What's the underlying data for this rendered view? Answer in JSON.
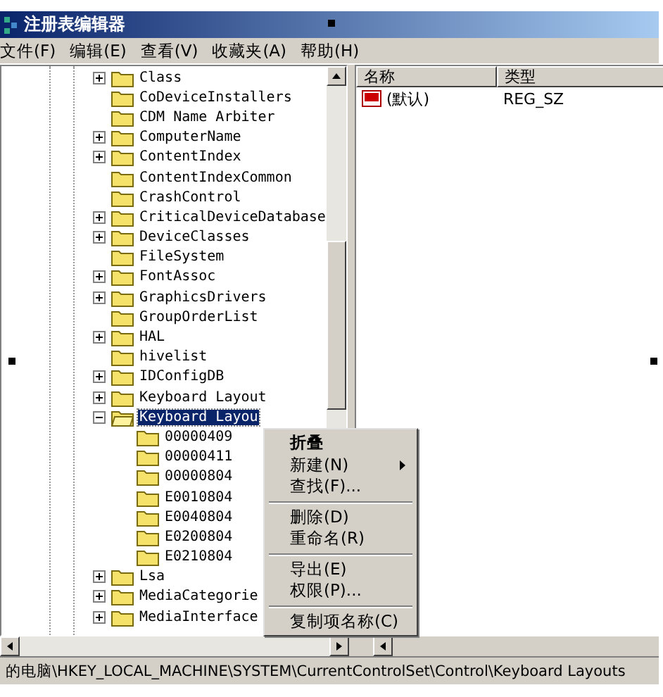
{
  "window": {
    "title": "注册表编辑器"
  },
  "menu_bar": [
    "文件(F)",
    "编辑(E)",
    "查看(V)",
    "收藏夹(A)",
    "帮助(H)"
  ],
  "tree": [
    {
      "label": "Class",
      "expanded": false,
      "selected": false
    },
    {
      "label": "CoDeviceInstallers",
      "selected": false
    },
    {
      "label": "CDM Name Arbiter",
      "selected": false
    },
    {
      "label": "ComputerName",
      "expanded": false,
      "selected": false
    },
    {
      "label": "ContentIndex",
      "expanded": false,
      "selected": false
    },
    {
      "label": "ContentIndexCommon",
      "selected": false
    },
    {
      "label": "CrashControl",
      "selected": false
    },
    {
      "label": "CriticalDeviceDatabase",
      "expanded": false,
      "selected": false
    },
    {
      "label": "DeviceClasses",
      "expanded": false,
      "selected": false
    },
    {
      "label": "FileSystem",
      "selected": false
    },
    {
      "label": "FontAssoc",
      "expanded": false,
      "selected": false
    },
    {
      "label": "GraphicsDrivers",
      "expanded": false,
      "selected": false
    },
    {
      "label": "GroupOrderList",
      "selected": false
    },
    {
      "label": "HAL",
      "expanded": false,
      "selected": false
    },
    {
      "label": "hivelist",
      "selected": false
    },
    {
      "label": "IDConfigDB",
      "expanded": false,
      "selected": false
    },
    {
      "label": "Keyboard Layout",
      "expanded": false,
      "selected": false
    },
    {
      "label": "Keyboard Layou",
      "expanded": true,
      "selected": true,
      "children": [
        {
          "label": "00000409",
          "selected": false
        },
        {
          "label": "00000411",
          "selected": false
        },
        {
          "label": "00000804",
          "selected": false
        },
        {
          "label": "E0010804",
          "selected": false
        },
        {
          "label": "E0040804",
          "selected": false
        },
        {
          "label": "E0200804",
          "selected": false
        },
        {
          "label": "E0210804",
          "selected": false
        }
      ]
    },
    {
      "label": "Lsa",
      "expanded": false,
      "selected": false
    },
    {
      "label": "MediaCategorie",
      "expanded": false,
      "selected": false
    },
    {
      "label": "MediaInterface",
      "expanded": false,
      "selected": false
    }
  ],
  "values_list": {
    "columns": [
      "名称",
      "类型"
    ],
    "rows": [
      {
        "name": "(默认)",
        "type": "REG_SZ"
      }
    ]
  },
  "context_menu": [
    {
      "kind": "item",
      "label": "折叠",
      "default": true,
      "submenu": false
    },
    {
      "kind": "item",
      "label": "新建(N)",
      "default": false,
      "submenu": true
    },
    {
      "kind": "item",
      "label": "查找(F)...",
      "default": false,
      "submenu": false
    },
    {
      "kind": "separator"
    },
    {
      "kind": "item",
      "label": "删除(D)",
      "default": false,
      "submenu": false
    },
    {
      "kind": "item",
      "label": "重命名(R)",
      "default": false,
      "submenu": false
    },
    {
      "kind": "separator"
    },
    {
      "kind": "item",
      "label": "导出(E)",
      "default": false,
      "submenu": false
    },
    {
      "kind": "item",
      "label": "权限(P)...",
      "default": false,
      "submenu": false
    },
    {
      "kind": "separator"
    },
    {
      "kind": "item",
      "label": "复制项名称(C)",
      "default": false,
      "submenu": false
    }
  ],
  "status_bar": "的电脑\\HKEY_LOCAL_MACHINE\\SYSTEM\\CurrentControlSet\\Control\\Keyboard Layouts"
}
